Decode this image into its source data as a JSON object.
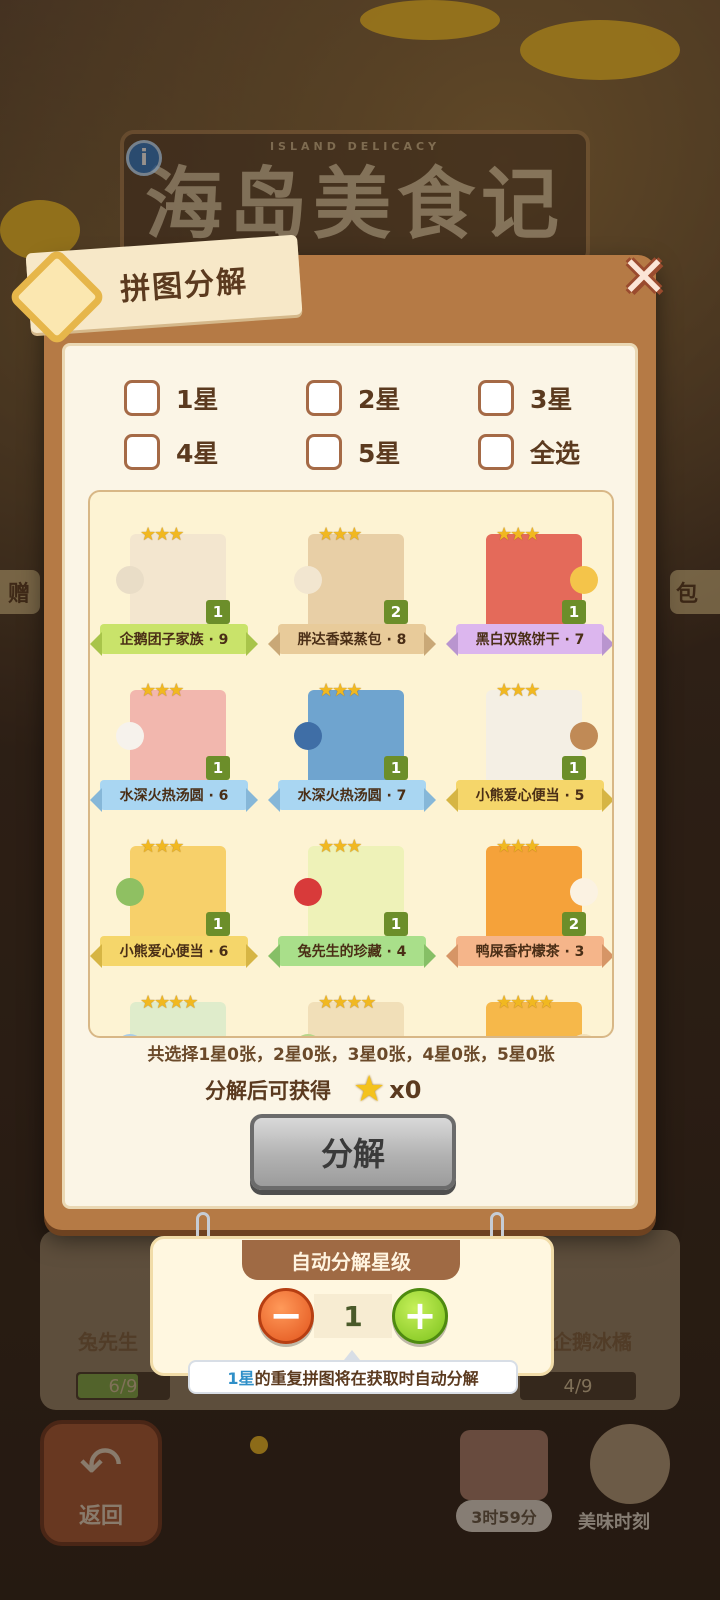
{
  "background": {
    "game_title": "海岛美食记",
    "game_subtitle": "ISLAND DELICACY",
    "side_left_text": "赠",
    "side_right_text": "包",
    "card_left_label": "兔先生",
    "card_right_label": "企鹅冰橘",
    "progress_left": "6/9",
    "progress_right": "4/9",
    "back_label": "返回",
    "timer_text": "3时59分",
    "moment_label": "美味时刻"
  },
  "dialog": {
    "title": "拼图分解",
    "close_icon": "close-x-icon",
    "filters": [
      {
        "label": "1星"
      },
      {
        "label": "2星"
      },
      {
        "label": "3星"
      },
      {
        "label": "4星"
      },
      {
        "label": "5星"
      },
      {
        "label": "全选"
      }
    ],
    "pieces": [
      {
        "name": "企鹅团子家族 · 9",
        "count": "1",
        "stars": "★★★",
        "ribbon": "green",
        "art": "#f3e6cf",
        "knob": "#e9ddc7"
      },
      {
        "name": "胖达香菜蒸包 · 8",
        "count": "2",
        "stars": "★★★",
        "ribbon": "tan",
        "art": "#e8cfa6",
        "knob": "#f2e6d0"
      },
      {
        "name": "黑白双煞饼干 · 7",
        "count": "1",
        "stars": "★★★",
        "ribbon": "purple",
        "art": "#e46a5a",
        "knob": "#f4c44a"
      },
      {
        "name": "水深火热汤圆 · 6",
        "count": "1",
        "stars": "★★★",
        "ribbon": "blue",
        "art": "#f2b7ae",
        "knob": "#f6f2ec"
      },
      {
        "name": "水深火热汤圆 · 7",
        "count": "1",
        "stars": "★★★",
        "ribbon": "blue",
        "art": "#6fa4cf",
        "knob": "#3f6ea6"
      },
      {
        "name": "小熊爱心便当 · 5",
        "count": "1",
        "stars": "★★★",
        "ribbon": "yellow",
        "art": "#f4efe4",
        "knob": "#c08a56"
      },
      {
        "name": "小熊爱心便当 · 6",
        "count": "1",
        "stars": "★★★",
        "ribbon": "yellow",
        "art": "#f7d06a",
        "knob": "#8fc062"
      },
      {
        "name": "兔先生的珍藏 · 4",
        "count": "1",
        "stars": "★★★",
        "ribbon": "lgreen",
        "art": "#eef2b8",
        "knob": "#d83a3a"
      },
      {
        "name": "鸭屎香柠檬茶 · 3",
        "count": "2",
        "stars": "★★★",
        "ribbon": "orange",
        "art": "#f5a23a",
        "knob": "#fbf2e2"
      },
      {
        "name": "",
        "count": "",
        "stars": "★★★★",
        "ribbon": "",
        "art": "#dfeccb",
        "knob": "#a9cde8"
      },
      {
        "name": "",
        "count": "",
        "stars": "★★★★",
        "ribbon": "",
        "art": "#f1dfb8",
        "knob": "#b7d68a"
      },
      {
        "name": "",
        "count": "",
        "stars": "★★★★",
        "ribbon": "",
        "art": "#f6b84a",
        "knob": "#f2e0b8"
      }
    ],
    "summary": "共选择1星0张，2星0张，3星0张，4星0张，5星0张",
    "reward_label": "分解后可获得",
    "reward_icon": "star-icon",
    "reward_value": "x0",
    "decompose_label": "分解"
  },
  "auto": {
    "title": "自动分解星级",
    "minus_icon": "minus-icon",
    "plus_icon": "plus-icon",
    "value": "1",
    "tip_highlight": "1星",
    "tip_rest": "的重复拼图将在获取时自动分解"
  }
}
